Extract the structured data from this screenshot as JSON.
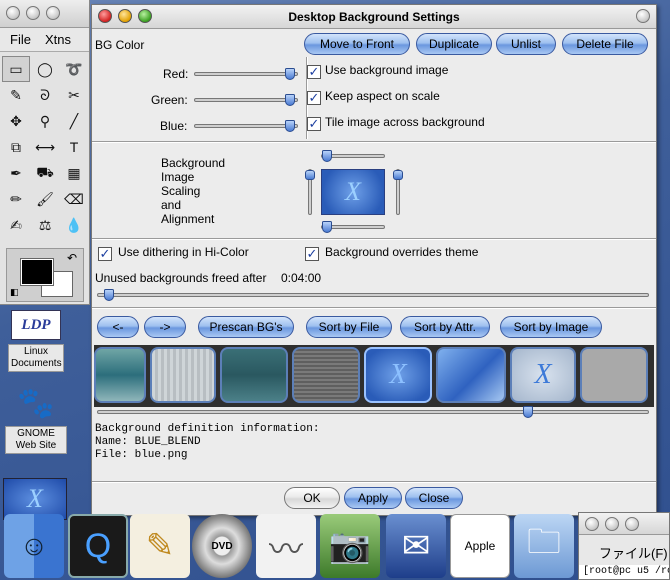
{
  "toolbox": {
    "menu": [
      "File",
      "Xtns"
    ],
    "tools": [
      {
        "name": "rect-select-icon",
        "glyph": "▭"
      },
      {
        "name": "ellipse-select-icon",
        "glyph": "◯"
      },
      {
        "name": "lasso-icon",
        "glyph": "➰"
      },
      {
        "name": "magic-wand-icon",
        "glyph": "✎"
      },
      {
        "name": "bezier-select-icon",
        "glyph": "ᘐ"
      },
      {
        "name": "scissors-icon",
        "glyph": "✂"
      },
      {
        "name": "move-icon",
        "glyph": "✥"
      },
      {
        "name": "magnify-icon",
        "glyph": "⚲"
      },
      {
        "name": "crop-knife-icon",
        "glyph": "╱"
      },
      {
        "name": "transform-icon",
        "glyph": "⧉"
      },
      {
        "name": "flip-icon",
        "glyph": "⟷"
      },
      {
        "name": "text-icon",
        "glyph": "T"
      },
      {
        "name": "color-picker-icon",
        "glyph": "✒"
      },
      {
        "name": "bucket-fill-icon",
        "glyph": "⛟"
      },
      {
        "name": "gradient-icon",
        "glyph": "▦"
      },
      {
        "name": "pencil-icon",
        "glyph": "✏"
      },
      {
        "name": "paintbrush-icon",
        "glyph": "🖌"
      },
      {
        "name": "eraser-icon",
        "glyph": "⌫"
      },
      {
        "name": "airbrush-icon",
        "glyph": "✍"
      },
      {
        "name": "clone-stamp-icon",
        "glyph": "⚖"
      },
      {
        "name": "smudge-icon",
        "glyph": "💧"
      }
    ]
  },
  "desktop": {
    "ldp_logo": "LDP",
    "ldp_label": "Linux Documents",
    "gnome_label": "GNOME Web Site",
    "mini_preview": "X"
  },
  "dialog": {
    "title": "Desktop Background Settings",
    "bg_color_label": "BG Color",
    "buttons": {
      "move_to_front": "Move to Front",
      "duplicate": "Duplicate",
      "unlist": "Unlist",
      "delete_file": "Delete File"
    },
    "colors": {
      "red": "Red:",
      "green": "Green:",
      "blue": "Blue:"
    },
    "checks": {
      "use_bg_image": "Use background image",
      "keep_aspect": "Keep aspect on scale",
      "tile_image": "Tile image across background",
      "dithering": "Use dithering in Hi-Color",
      "overrides_theme": "Background overrides theme"
    },
    "scaling_label_lines": [
      "Background",
      "Image",
      "Scaling",
      "and",
      "Alignment"
    ],
    "preview_glyph": "X",
    "unused_freed_label": "Unused backgrounds freed after",
    "unused_freed_value": "0:04:00",
    "nav_buttons": {
      "prev": "<-",
      "next": "->",
      "prescan": "Prescan BG's",
      "sort_file": "Sort by File",
      "sort_attr": "Sort by Attr.",
      "sort_image": "Sort by Image"
    },
    "info_lines": [
      "Background definition information:",
      "Name: BLUE_BLEND",
      "File: blue.png"
    ],
    "bottom_buttons": {
      "ok": "OK",
      "apply": "Apply",
      "close": "Close"
    }
  },
  "dock_items": [
    "finder-icon",
    "quicktime-icon",
    "textedit-icon",
    "dvd-player-icon",
    "sound-file-icon",
    "iphoto-icon",
    "mail-icon",
    "apple-web-icon",
    "folder-icon"
  ],
  "terminal": {
    "menu_label": "ファイル(F)",
    "prompt": "[root@pc u5 /ro"
  }
}
